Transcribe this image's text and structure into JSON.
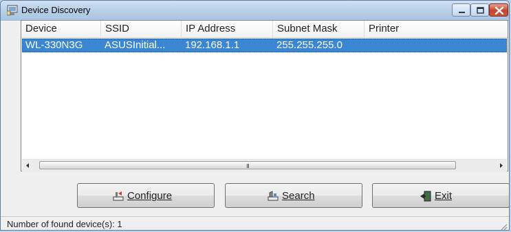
{
  "window": {
    "title": "Device Discovery"
  },
  "table": {
    "columns": [
      "Device",
      "SSID",
      "IP Address",
      "Subnet Mask",
      "Printer"
    ],
    "rows": [
      {
        "device": "WL-330N3G",
        "ssid": "ASUSInitial...",
        "ip": "192.168.1.1",
        "mask": "255.255.255.0",
        "printer": ""
      }
    ],
    "selected_row": 0
  },
  "scrollbar": {
    "grip_glyph": "III"
  },
  "buttons": {
    "configure": {
      "mnemonic": "C",
      "rest": "onfigure",
      "icon": "configure-icon"
    },
    "search": {
      "mnemonic": "S",
      "rest": "earch",
      "icon": "search-icon"
    },
    "exit": {
      "mnemonic": "E",
      "rest": "xit",
      "icon": "exit-icon"
    }
  },
  "status": {
    "text": "Number of found device(s): 1"
  },
  "colors": {
    "selection": "#3a86d2",
    "titlebar": "#b8d0ea",
    "close_button": "#c6442b"
  }
}
